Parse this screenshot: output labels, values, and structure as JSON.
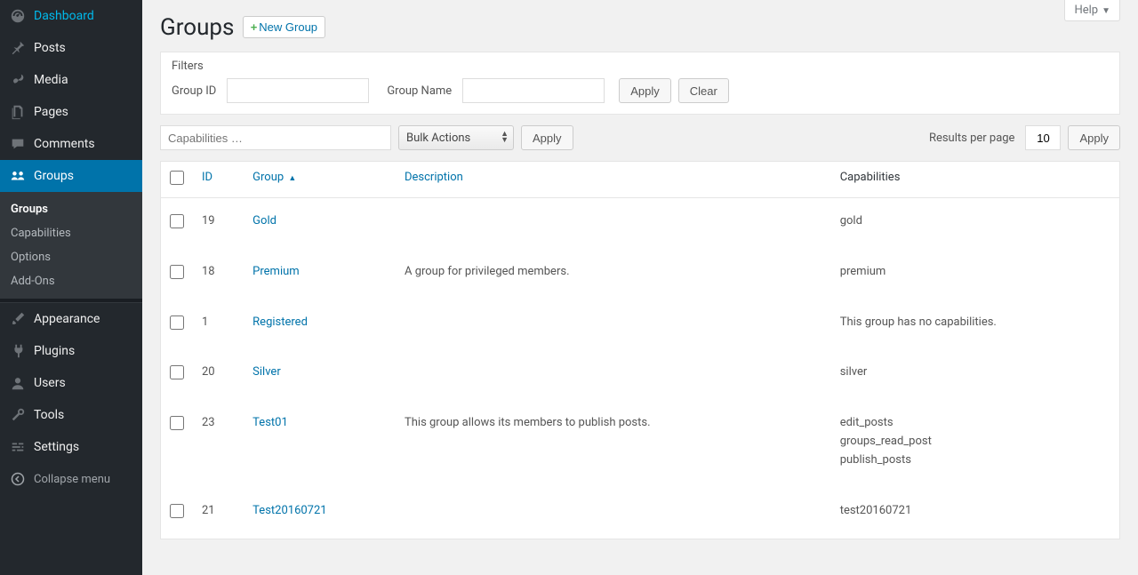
{
  "sidebar": {
    "items": [
      {
        "label": "Dashboard",
        "icon": "gauge"
      },
      {
        "label": "Posts",
        "icon": "pin"
      },
      {
        "label": "Media",
        "icon": "media"
      },
      {
        "label": "Pages",
        "icon": "pages"
      },
      {
        "label": "Comments",
        "icon": "comment"
      },
      {
        "label": "Groups",
        "icon": "groups",
        "active": true
      },
      {
        "label": "Appearance",
        "icon": "brush"
      },
      {
        "label": "Plugins",
        "icon": "plug"
      },
      {
        "label": "Users",
        "icon": "user"
      },
      {
        "label": "Tools",
        "icon": "wrench"
      },
      {
        "label": "Settings",
        "icon": "sliders"
      }
    ],
    "submenu": [
      {
        "label": "Groups",
        "current": true
      },
      {
        "label": "Capabilities"
      },
      {
        "label": "Options"
      },
      {
        "label": "Add-Ons"
      }
    ],
    "collapse_label": "Collapse menu"
  },
  "help_label": "Help",
  "page_title": "Groups",
  "new_group_btn": "New Group",
  "filters": {
    "heading": "Filters",
    "group_id_label": "Group ID",
    "group_id_value": "",
    "group_name_label": "Group Name",
    "group_name_value": "",
    "apply_label": "Apply",
    "clear_label": "Clear"
  },
  "toolbar": {
    "capabilities_placeholder": "Capabilities …",
    "bulk_actions_label": "Bulk Actions",
    "apply_label": "Apply",
    "results_label": "Results per page",
    "results_value": "10",
    "apply2_label": "Apply"
  },
  "table": {
    "headers": {
      "id": "ID",
      "group": "Group",
      "description": "Description",
      "capabilities": "Capabilities"
    },
    "sort_column": "group",
    "sort_dir": "asc",
    "rows": [
      {
        "id": "19",
        "group": "Gold",
        "description": "",
        "capabilities": [
          "gold"
        ]
      },
      {
        "id": "18",
        "group": "Premium",
        "description": "A group for privileged members.",
        "capabilities": [
          "premium"
        ]
      },
      {
        "id": "1",
        "group": "Registered",
        "description": "",
        "capabilities_text": "This group has no capabilities."
      },
      {
        "id": "20",
        "group": "Silver",
        "description": "",
        "capabilities": [
          "silver"
        ]
      },
      {
        "id": "23",
        "group": "Test01",
        "description": "This group allows its members to publish posts.",
        "capabilities": [
          "edit_posts",
          "groups_read_post",
          "publish_posts"
        ]
      },
      {
        "id": "21",
        "group": "Test20160721",
        "description": "",
        "capabilities": [
          "test20160721"
        ]
      }
    ]
  }
}
